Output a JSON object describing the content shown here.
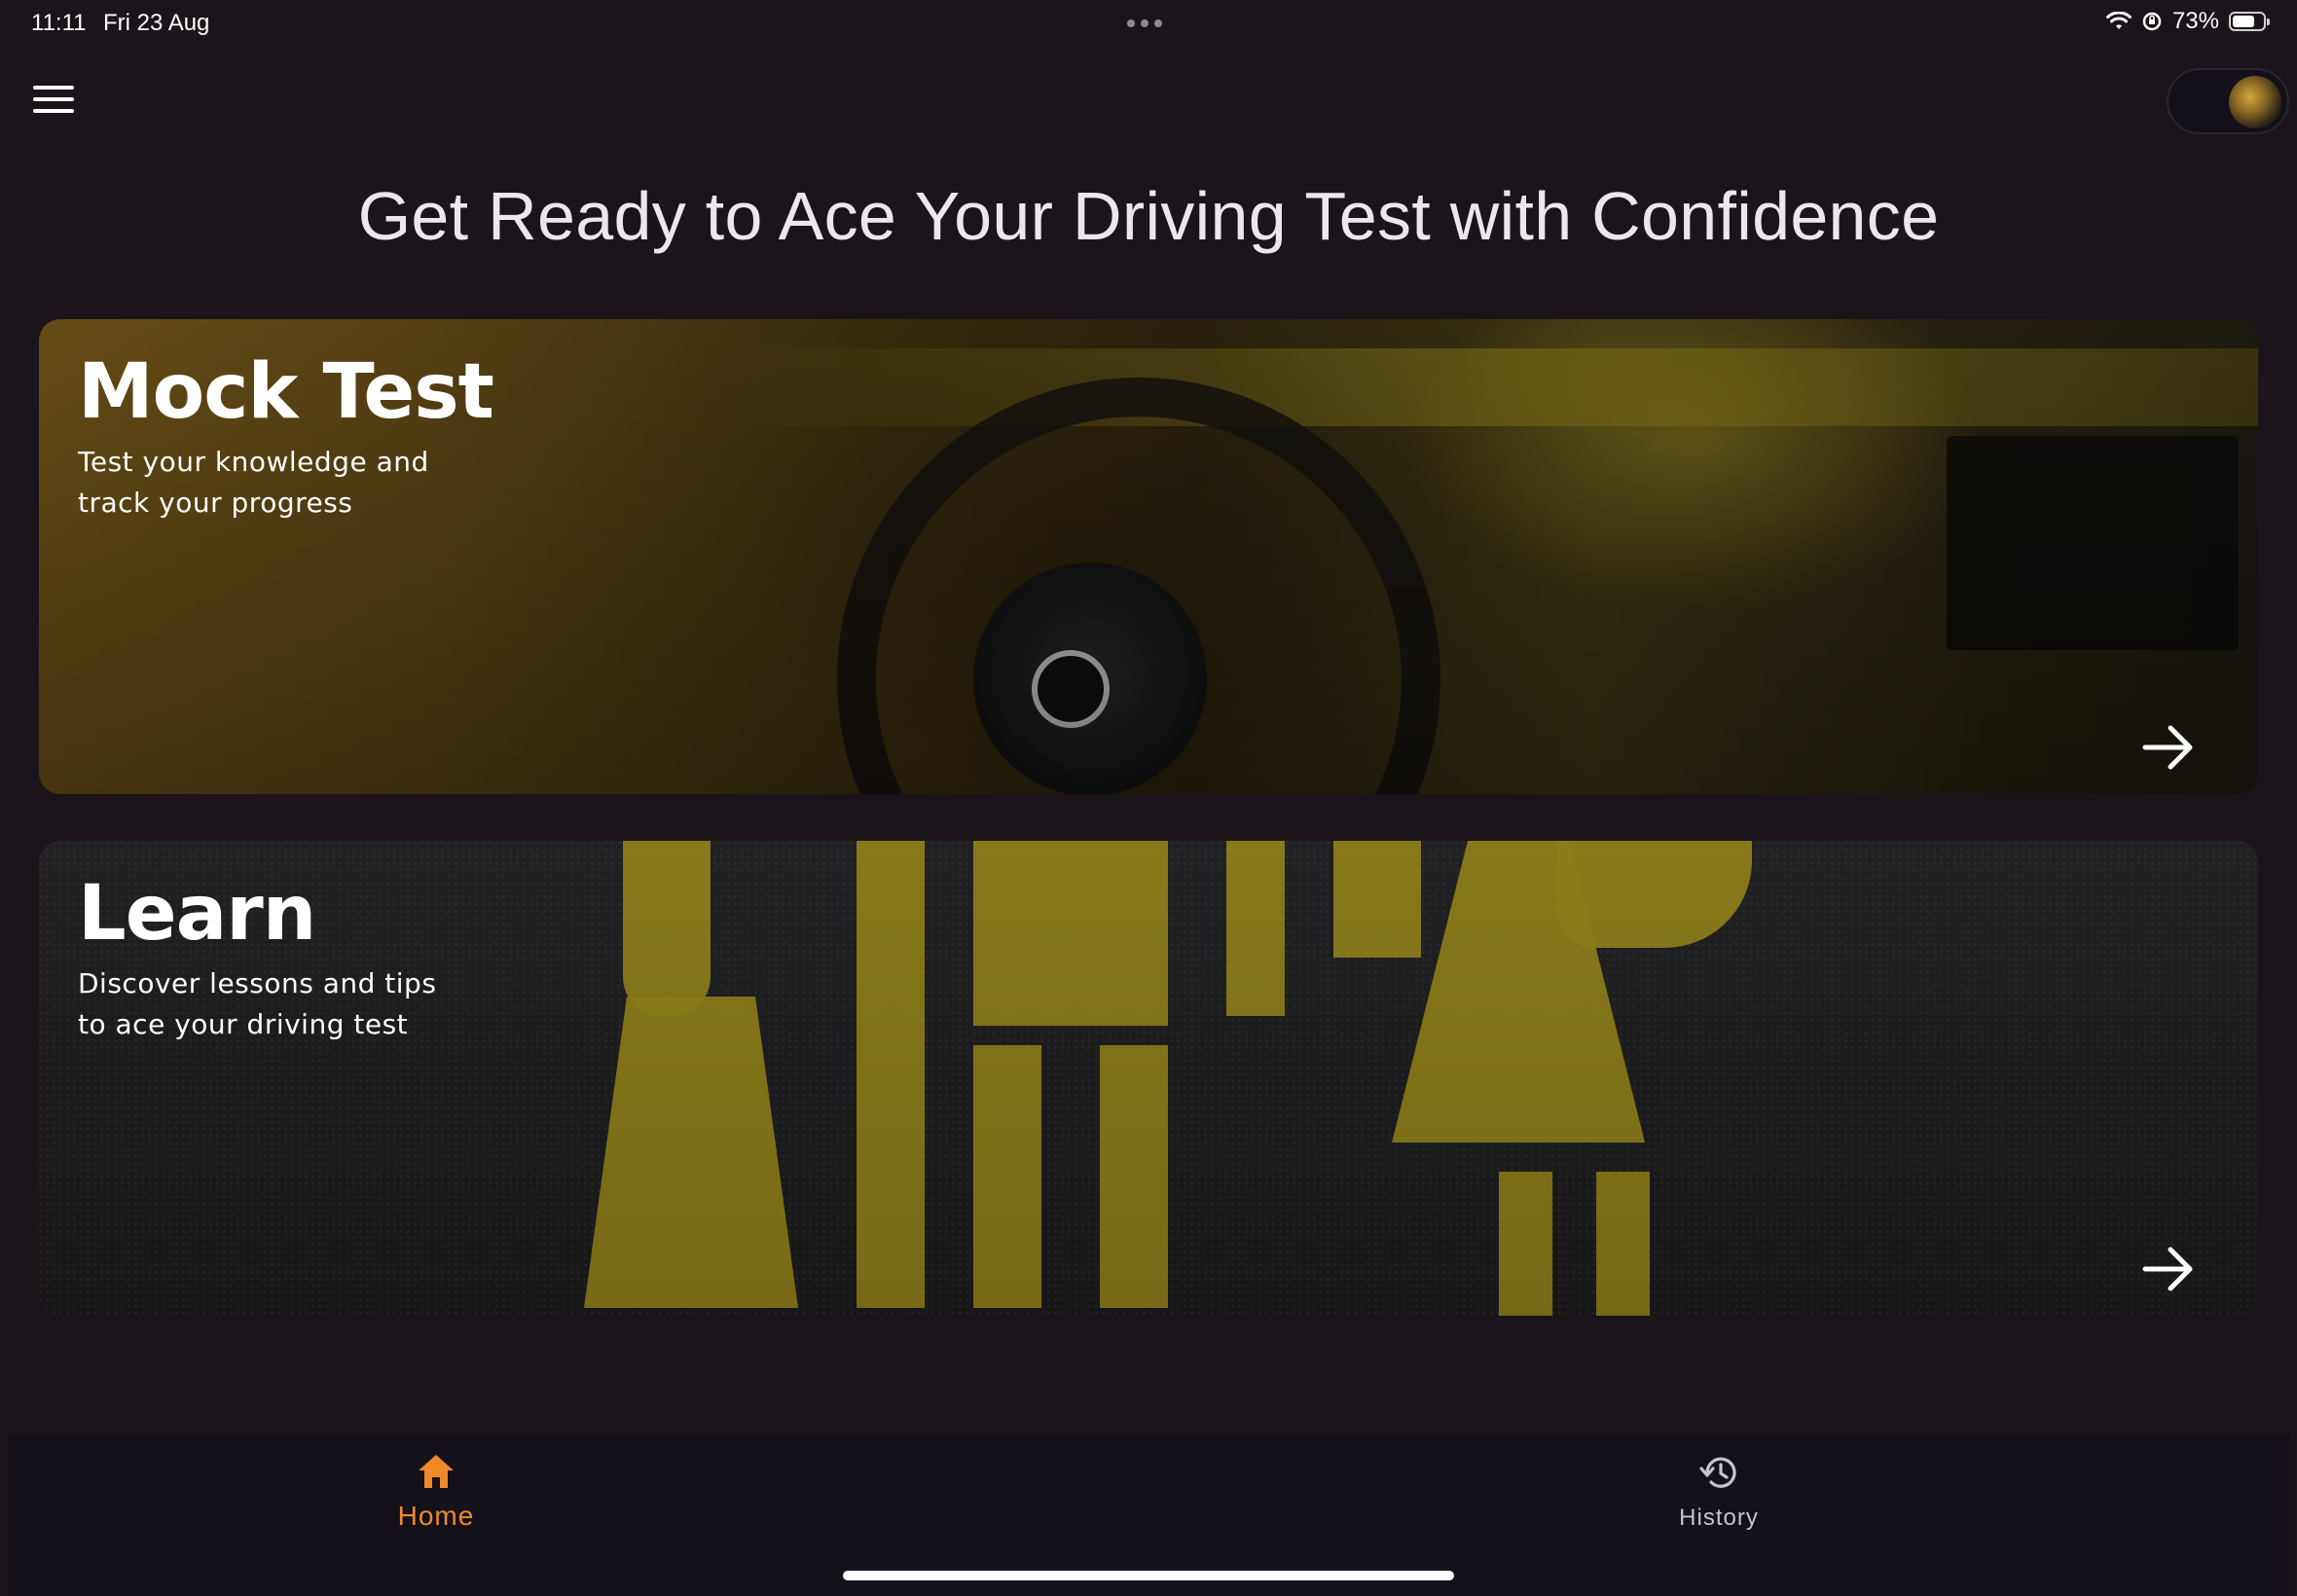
{
  "status_bar": {
    "time": "11:11",
    "date": "Fri 23 Aug",
    "battery_text": "73%",
    "battery_level": 0.73
  },
  "header": {
    "menu_icon": "hamburger-menu-icon",
    "avatar_icon": "user-avatar"
  },
  "headline": "Get Ready to Ace Your Driving Test with Confidence",
  "cards": [
    {
      "title": "Mock Test",
      "subtitle_line1": "Test your knowledge and",
      "subtitle_line2": "track your progress",
      "arrow_icon": "arrow-right-icon"
    },
    {
      "title": "Learn",
      "subtitle_line1": "Discover lessons and tips",
      "subtitle_line2": "to ace your driving test",
      "arrow_icon": "arrow-right-icon"
    }
  ],
  "bottom_nav": {
    "items": [
      {
        "label": "Home",
        "icon": "home-icon",
        "active": true
      },
      {
        "label": "History",
        "icon": "history-icon",
        "active": false
      }
    ]
  },
  "colors": {
    "background": "#1b141a",
    "accent": "#f0882a",
    "nav_background": "#14111a",
    "road_paint": "#a6941f"
  }
}
